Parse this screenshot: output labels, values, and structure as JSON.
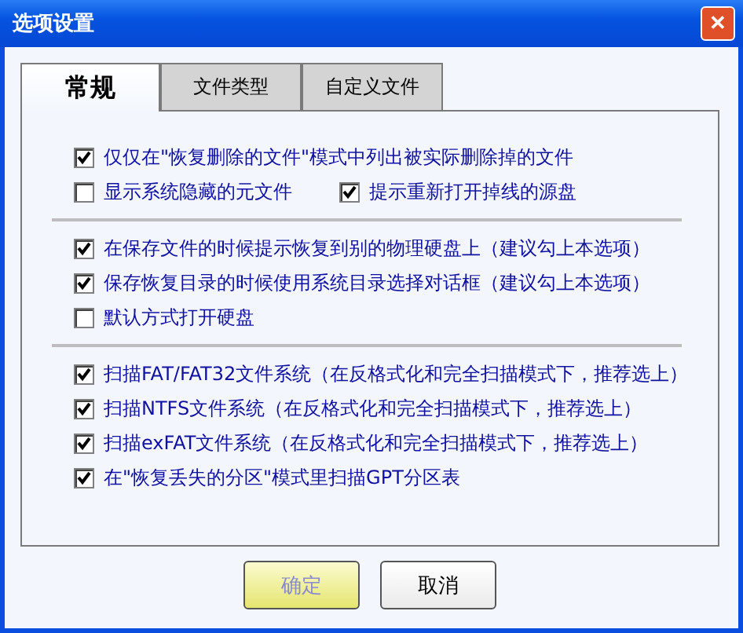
{
  "window": {
    "title": "选项设置",
    "close": "✕"
  },
  "tabs": [
    {
      "label": "常规",
      "selected": true
    },
    {
      "label": "文件类型",
      "selected": false
    },
    {
      "label": "自定义文件",
      "selected": false
    }
  ],
  "sections": [
    {
      "rows": [
        [
          {
            "label": "仅仅在\"恢复删除的文件\"模式中列出被实际删除掉的文件",
            "checked": true
          }
        ],
        [
          {
            "label": "显示系统隐藏的元文件",
            "checked": false
          },
          {
            "label": "提示重新打开掉线的源盘",
            "checked": true
          }
        ]
      ]
    },
    {
      "rows": [
        [
          {
            "label": "在保存文件的时候提示恢复到别的物理硬盘上（建议勾上本选项）",
            "checked": true
          }
        ],
        [
          {
            "label": "保存恢复目录的时候使用系统目录选择对话框（建议勾上本选项）",
            "checked": true
          }
        ],
        [
          {
            "label": "默认方式打开硬盘",
            "checked": false
          }
        ]
      ]
    },
    {
      "rows": [
        [
          {
            "label": "扫描FAT/FAT32文件系统（在反格式化和完全扫描模式下，推荐选上）",
            "checked": true
          }
        ],
        [
          {
            "label": "扫描NTFS文件系统（在反格式化和完全扫描模式下，推荐选上）",
            "checked": true
          }
        ],
        [
          {
            "label": "扫描exFAT文件系统（在反格式化和完全扫描模式下，推荐选上）",
            "checked": true
          }
        ],
        [
          {
            "label": "在\"恢复丢失的分区\"模式里扫描GPT分区表",
            "checked": true
          }
        ]
      ]
    }
  ],
  "buttons": [
    {
      "label": "确定",
      "highlighted": true
    },
    {
      "label": "取消",
      "highlighted": false
    }
  ]
}
